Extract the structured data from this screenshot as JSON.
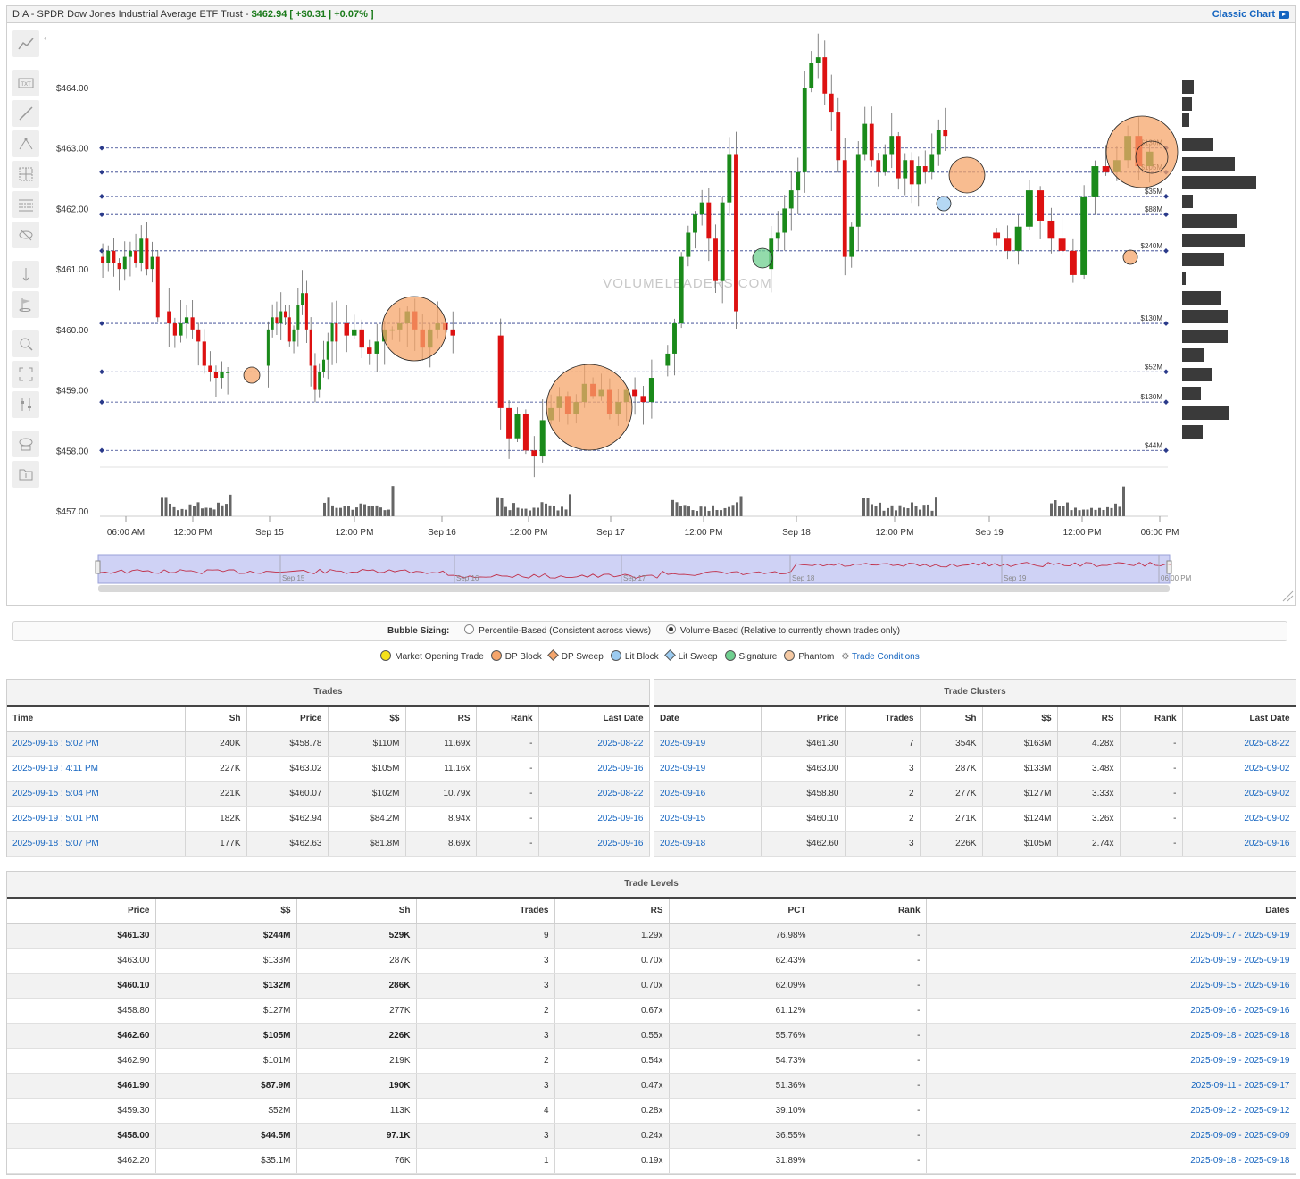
{
  "header": {
    "symbol_title": "DIA - SPDR Dow Jones Industrial Average ETF Trust - ",
    "price": "$462.94",
    "change": "[ +$0.31 | +0.07% ]",
    "classic_chart": "Classic Chart"
  },
  "chart": {
    "watermark": "VOLUMELEADERS.COM",
    "y_ticks": [
      "$464.00",
      "$463.00",
      "$462.00",
      "$461.00",
      "$460.00",
      "$459.00",
      "$458.00",
      "$457.00"
    ],
    "x_ticks": [
      "06:00 AM",
      "12:00 PM",
      "Sep 15",
      "12:00 PM",
      "Sep 16",
      "12:00 PM",
      "Sep 17",
      "12:00 PM",
      "Sep 18",
      "12:00 PM",
      "Sep 19",
      "12:00 PM",
      "06:00 PM"
    ],
    "navigator_labels": [
      "Sep 15",
      "Sep 16",
      "Sep 17",
      "Sep 18",
      "Sep 19",
      "06:00 PM"
    ],
    "level_labels": [
      {
        "label": "$130M",
        "price": 463.0
      },
      {
        "label": "$105M",
        "price": 462.6
      },
      {
        "label": "$35M",
        "price": 462.2
      },
      {
        "label": "$88M",
        "price": 461.9
      },
      {
        "label": "$240M",
        "price": 461.3
      },
      {
        "label": "$130M",
        "price": 460.1
      },
      {
        "label": "$52M",
        "price": 459.3
      },
      {
        "label": "$130M",
        "price": 458.8
      },
      {
        "label": "$44M",
        "price": 458.0
      }
    ],
    "colors": {
      "up": "#1a8a1a",
      "down": "#dd1111",
      "bubble": "#f5a56b",
      "lit": "#9ccbf0",
      "signature": "#6fcf8f",
      "level_line": "#2a3a8a"
    }
  },
  "chart_data": {
    "type": "candlestick",
    "title": "DIA - SPDR Dow Jones Industrial Average ETF Trust",
    "ylim": [
      457.0,
      464.5
    ],
    "x_range": [
      "Sep 12 04:00 PM",
      "Sep 19 06:00 PM"
    ],
    "sessions": [
      {
        "day": "Sep 12",
        "open": 461.3,
        "close": 461.0,
        "high": 462.0,
        "low": 460.8
      },
      {
        "day": "Sep 15",
        "open": 461.2,
        "close": 459.3,
        "high": 461.5,
        "low": 458.9
      },
      {
        "day": "Sep 15 PM",
        "open": 459.5,
        "close": 460.4,
        "high": 460.9,
        "low": 458.8
      },
      {
        "day": "Sep 16",
        "open": 460.0,
        "close": 458.2,
        "high": 460.3,
        "low": 457.8
      },
      {
        "day": "Sep 17",
        "open": 458.2,
        "close": 460.5,
        "high": 463.2,
        "low": 458.0
      },
      {
        "day": "Sep 18",
        "open": 462.5,
        "close": 461.6,
        "high": 464.7,
        "low": 460.6
      },
      {
        "day": "Sep 19",
        "open": 461.5,
        "close": 462.94,
        "high": 463.2,
        "low": 460.9
      }
    ],
    "trade_bubbles": [
      {
        "type": "DP Block",
        "price": 459.25,
        "label": "Sep 15"
      },
      {
        "type": "DP Block",
        "price": 460.0,
        "label": "Sep 15"
      },
      {
        "type": "DP Block",
        "price": 458.8,
        "label": "Sep 16"
      },
      {
        "type": "Signature",
        "price": 461.2,
        "label": "Sep 17"
      },
      {
        "type": "Lit Block",
        "price": 462.0,
        "label": "Sep 18"
      },
      {
        "type": "DP Block",
        "price": 462.6,
        "label": "Sep 18"
      },
      {
        "type": "DP Block",
        "price": 463.0,
        "label": "Sep 19"
      },
      {
        "type": "DP Block",
        "price": 461.2,
        "label": "Sep 19"
      }
    ]
  },
  "bubble_sizing": {
    "label": "Bubble Sizing:",
    "option1": "Percentile-Based (Consistent across views)",
    "option2": "Volume-Based (Relative to currently shown trades only)"
  },
  "legend": [
    {
      "label": "Market Opening Trade",
      "color": "#f5e11a",
      "shape": "circle"
    },
    {
      "label": "DP Block",
      "color": "#f5a56b",
      "shape": "circle"
    },
    {
      "label": "DP Sweep",
      "color": "#f5a56b",
      "shape": "diamond"
    },
    {
      "label": "Lit Block",
      "color": "#9ccbf0",
      "shape": "circle"
    },
    {
      "label": "Lit Sweep",
      "color": "#9ccbf0",
      "shape": "diamond"
    },
    {
      "label": "Signature",
      "color": "#6fcf8f",
      "shape": "circle"
    },
    {
      "label": "Phantom",
      "color": "#f5c9a3",
      "shape": "circle"
    },
    {
      "label": "Trade Conditions",
      "color": "#888888",
      "shape": "link"
    }
  ],
  "trades": {
    "title": "Trades",
    "headers": [
      "Time",
      "Sh",
      "Price",
      "$$",
      "RS",
      "Rank",
      "Last Date"
    ],
    "rows": [
      [
        "2025-09-16 : 5:02 PM",
        "240K",
        "$458.78",
        "$110M",
        "11.69x",
        "-",
        "2025-08-22"
      ],
      [
        "2025-09-19 : 4:11 PM",
        "227K",
        "$463.02",
        "$105M",
        "11.16x",
        "-",
        "2025-09-16"
      ],
      [
        "2025-09-15 : 5:04 PM",
        "221K",
        "$460.07",
        "$102M",
        "10.79x",
        "-",
        "2025-08-22"
      ],
      [
        "2025-09-19 : 5:01 PM",
        "182K",
        "$462.94",
        "$84.2M",
        "8.94x",
        "-",
        "2025-09-16"
      ],
      [
        "2025-09-18 : 5:07 PM",
        "177K",
        "$462.63",
        "$81.8M",
        "8.69x",
        "-",
        "2025-09-16"
      ]
    ]
  },
  "clusters": {
    "title": "Trade Clusters",
    "headers": [
      "Date",
      "Price",
      "Trades",
      "Sh",
      "$$",
      "RS",
      "Rank",
      "Last Date"
    ],
    "rows": [
      [
        "2025-09-19",
        "$461.30",
        "7",
        "354K",
        "$163M",
        "4.28x",
        "-",
        "2025-08-22"
      ],
      [
        "2025-09-19",
        "$463.00",
        "3",
        "287K",
        "$133M",
        "3.48x",
        "-",
        "2025-09-02"
      ],
      [
        "2025-09-16",
        "$458.80",
        "2",
        "277K",
        "$127M",
        "3.33x",
        "-",
        "2025-09-02"
      ],
      [
        "2025-09-15",
        "$460.10",
        "2",
        "271K",
        "$124M",
        "3.26x",
        "-",
        "2025-09-02"
      ],
      [
        "2025-09-18",
        "$462.60",
        "3",
        "226K",
        "$105M",
        "2.74x",
        "-",
        "2025-09-16"
      ]
    ]
  },
  "levels": {
    "title": "Trade Levels",
    "headers": [
      "Price",
      "$$",
      "Sh",
      "Trades",
      "RS",
      "PCT",
      "Rank",
      "Dates"
    ],
    "rows": [
      [
        "$461.30",
        "$244M",
        "529K",
        "9",
        "1.29x",
        "76.98%",
        "-",
        "2025-09-17 - 2025-09-19"
      ],
      [
        "$463.00",
        "$133M",
        "287K",
        "3",
        "0.70x",
        "62.43%",
        "-",
        "2025-09-19 - 2025-09-19"
      ],
      [
        "$460.10",
        "$132M",
        "286K",
        "3",
        "0.70x",
        "62.09%",
        "-",
        "2025-09-15 - 2025-09-16"
      ],
      [
        "$458.80",
        "$127M",
        "277K",
        "2",
        "0.67x",
        "61.12%",
        "-",
        "2025-09-16 - 2025-09-16"
      ],
      [
        "$462.60",
        "$105M",
        "226K",
        "3",
        "0.55x",
        "55.76%",
        "-",
        "2025-09-18 - 2025-09-18"
      ],
      [
        "$462.90",
        "$101M",
        "219K",
        "2",
        "0.54x",
        "54.73%",
        "-",
        "2025-09-19 - 2025-09-19"
      ],
      [
        "$461.90",
        "$87.9M",
        "190K",
        "3",
        "0.47x",
        "51.36%",
        "-",
        "2025-09-11 - 2025-09-17"
      ],
      [
        "$459.30",
        "$52M",
        "113K",
        "4",
        "0.28x",
        "39.10%",
        "-",
        "2025-09-12 - 2025-09-12"
      ],
      [
        "$458.00",
        "$44.5M",
        "97.1K",
        "3",
        "0.24x",
        "36.55%",
        "-",
        "2025-09-09 - 2025-09-09"
      ],
      [
        "$462.20",
        "$35.1M",
        "76K",
        "1",
        "0.19x",
        "31.89%",
        "-",
        "2025-09-18 - 2025-09-18"
      ]
    ]
  }
}
